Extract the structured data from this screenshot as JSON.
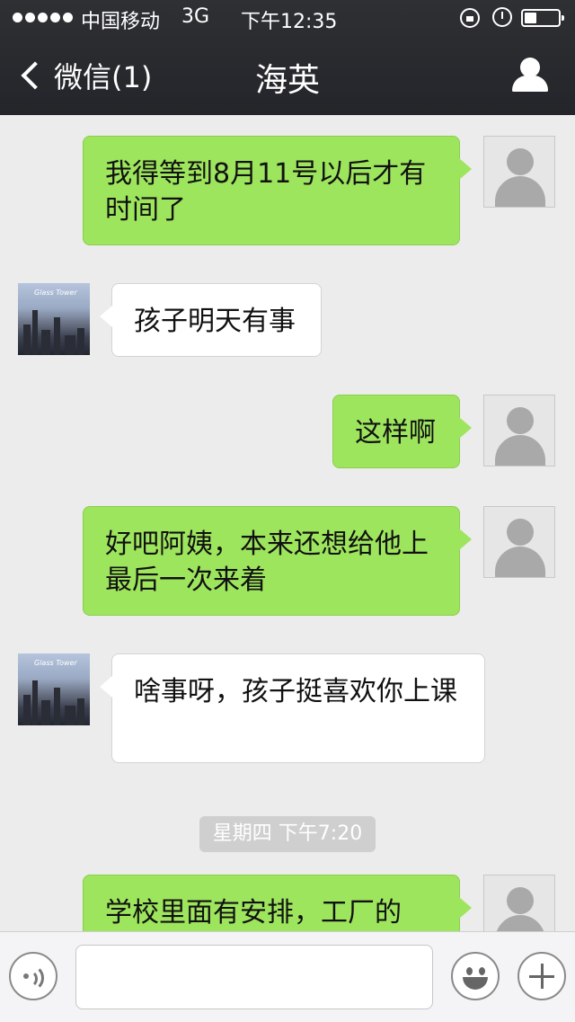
{
  "status_bar": {
    "carrier": "中国移动",
    "network": "3G",
    "time": "下午12:35",
    "battery_level": 0.35
  },
  "nav": {
    "back_label": "微信(1)",
    "title": "海英",
    "profile_icon": "person-icon"
  },
  "messages": [
    {
      "sender": "me",
      "text": "我得等到8月11号以后才有时间了"
    },
    {
      "sender": "them",
      "text": "孩子明天有事"
    },
    {
      "sender": "me",
      "text": "这样啊"
    },
    {
      "sender": "me",
      "text": "好吧阿姨，本来还想给他上最后一次来着"
    },
    {
      "sender": "them",
      "text": "啥事呀，孩子挺喜欢你上课"
    },
    {
      "sender": "me",
      "text": "学校里面有安排，工厂的"
    }
  ],
  "timestamp": "星期四 下午7:20",
  "input_bar": {
    "voice_icon": "voice-icon",
    "message_value": "",
    "emoji_icon": "emoji-icon",
    "add_icon": "plus-icon"
  },
  "colors": {
    "topbar": "#2a2b2f",
    "background": "#ececec",
    "my_bubble": "#9ee55e",
    "their_bubble": "#ffffff"
  }
}
